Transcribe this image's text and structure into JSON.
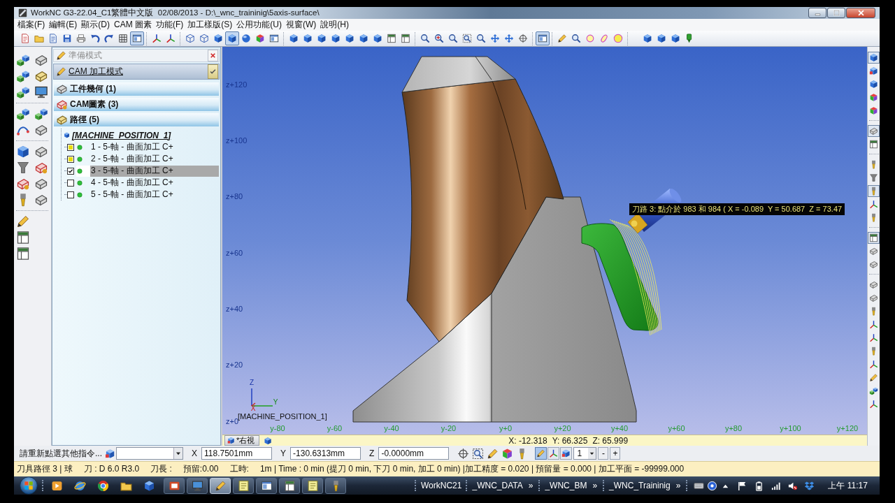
{
  "window": {
    "title": "WorkNC G3-22.04_C1繁體中文版  02/08/2013 - D:\\_wnc_traininig\\5axis-surface\\"
  },
  "menu": [
    "檔案(F)",
    "編輯(E)",
    "顯示(D)",
    "CAM 圖素",
    "功能(F)",
    "加工樣版(S)",
    "公用功能(U)",
    "視窗(W)",
    "說明(H)"
  ],
  "toolbar": [
    [
      {
        "pressed": false
      },
      {
        "pressed": false
      },
      {
        "pressed": false
      },
      {
        "pressed": false
      },
      {
        "pressed": false
      },
      {
        "pressed": false
      },
      {
        "pressed": false
      },
      {
        "pressed": false
      },
      {
        "pressed": true
      }
    ],
    [
      {
        "pressed": false
      },
      {
        "pressed": false
      }
    ],
    [
      {
        "pressed": false
      },
      {
        "pressed": false
      },
      {
        "pressed": false
      },
      {
        "pressed": true
      },
      {
        "pressed": false
      },
      {
        "pressed": false
      },
      {
        "pressed": false
      }
    ],
    [
      {
        "pressed": false
      },
      {
        "pressed": false
      },
      {
        "pressed": false
      },
      {
        "pressed": false
      },
      {
        "pressed": false
      },
      {
        "pressed": false
      },
      {
        "pressed": false
      },
      {
        "pressed": false
      },
      {
        "pressed": false
      }
    ],
    [
      {
        "pressed": false
      },
      {
        "pressed": false
      },
      {
        "pressed": false
      },
      {
        "pressed": false
      },
      {
        "pressed": false
      },
      {
        "pressed": false
      },
      {
        "pressed": false
      },
      {
        "pressed": false
      }
    ],
    [
      {
        "pressed": true
      }
    ],
    [
      {
        "pressed": false
      },
      {
        "pressed": false
      },
      {
        "pressed": false
      },
      {
        "pressed": false
      },
      {
        "pressed": false
      }
    ],
    [
      {
        "pressed": false
      },
      {
        "pressed": false
      },
      {
        "pressed": false
      },
      {
        "pressed": false
      }
    ]
  ],
  "right_toolbar": [
    [
      {
        "pressed": true
      },
      {
        "pressed": false
      },
      {
        "pressed": false
      },
      {
        "pressed": false
      },
      {
        "pressed": false
      }
    ],
    [
      {
        "pressed": true
      },
      {
        "pressed": false
      }
    ],
    [
      {
        "pressed": false
      },
      {
        "pressed": false
      },
      {
        "pressed": true
      },
      {
        "pressed": false
      },
      {
        "pressed": false
      }
    ],
    [
      {
        "pressed": true
      },
      {
        "pressed": false
      },
      {
        "pressed": false
      }
    ],
    [
      {
        "pressed": false
      },
      {
        "pressed": false
      },
      {
        "pressed": false
      },
      {
        "pressed": false
      },
      {
        "pressed": false
      },
      {
        "pressed": false
      },
      {
        "pressed": false
      },
      {
        "pressed": false
      },
      {
        "pressed": false
      },
      {
        "pressed": false
      }
    ]
  ],
  "modes": [
    {
      "label": "準備模式",
      "selected": false
    },
    {
      "label": "CAM 加工模式",
      "selected": true
    }
  ],
  "tree": [
    {
      "label": "工件幾何 (1)"
    },
    {
      "label": "CAM圖素 (3)"
    },
    {
      "label": "路徑 (5)",
      "children": [
        {
          "label": "[MACHINE_POSITION_1]",
          "children": [
            {
              "label": "1 - 5-軸 - 曲面加工 C+",
              "checked": false,
              "filled": true,
              "selected": false
            },
            {
              "label": "2 - 5-軸 - 曲面加工 C+",
              "checked": false,
              "filled": true,
              "selected": false
            },
            {
              "label": "3 - 5-軸 - 曲面加工 C+",
              "checked": true,
              "filled": false,
              "selected": true
            },
            {
              "label": "4 - 5-軸 - 曲面加工 C+",
              "checked": false,
              "filled": false,
              "selected": false
            },
            {
              "label": "5 - 5-軸 - 曲面加工 C+",
              "checked": false,
              "filled": false,
              "selected": false
            }
          ]
        }
      ]
    }
  ],
  "viewport": {
    "z_ticks": [
      "z+120",
      "z+100",
      "z+80",
      "z+60",
      "z+40",
      "z+20",
      "z+0"
    ],
    "y_ticks": [
      "y-80",
      "y-60",
      "y-40",
      "y-20",
      "y+0",
      "y+20",
      "y+40",
      "y+60",
      "y+80",
      "y+100",
      "y+120"
    ],
    "triad": [
      "Z",
      "X",
      "Y"
    ],
    "origin_label": "[MACHINE_POSITION_1]",
    "tooltip": "刀路 3: 點介於 983 和 984 ( X = -0.089  Y = 50.687  Z = 73.47"
  },
  "view_strip": {
    "view_tab": "*右視",
    "readout": [
      "X: -12.318",
      "Y: 66.325",
      "Z: 65.999"
    ]
  },
  "command_bar": {
    "prompt": "請重新點選其他指令...",
    "coords": [
      {
        "axis": "X",
        "value": "118.7501mm"
      },
      {
        "axis": "Y",
        "value": "-130.6313mm"
      },
      {
        "axis": "Z",
        "value": "-0.0000mm"
      }
    ],
    "toggles": [
      {
        "pressed": true
      },
      {
        "pressed": false
      },
      {
        "pressed": false
      }
    ],
    "step": "1",
    "buttons": [
      "-",
      "+"
    ]
  },
  "status_bar": [
    "刀具路徑 3 | 球",
    "刀 : D 6.0 R3.0",
    "刀長 :",
    "預留:0.00",
    "工時:",
    "1m | Time : 0 min (提刀 0 min, 下刀 0 min, 加工 0 min) |加工精度 = 0.020 | 預留量 = 0.000 | 加工平面 = -99999.000"
  ],
  "taskbar": {
    "tasks": [
      {
        "pressed": false
      },
      {
        "pressed": false
      },
      {
        "pressed": true
      },
      {
        "pressed": false
      },
      {
        "pressed": false
      },
      {
        "pressed": false
      },
      {
        "pressed": false
      },
      {
        "pressed": false
      }
    ],
    "toolbars": [
      {
        "label": "WorkNC21"
      },
      {
        "label": "_WNC_DATA",
        "more": "»"
      },
      {
        "label": "_WNC_BM",
        "more": "»"
      },
      {
        "label": "_WNC_Traininig",
        "more": "»"
      }
    ],
    "clock": "上午 11:17"
  }
}
